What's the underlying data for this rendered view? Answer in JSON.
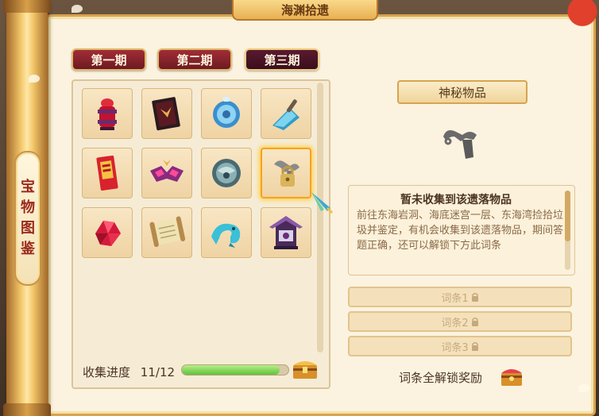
{
  "window": {
    "title": "海渊拾遗",
    "side_label_chars": [
      "宝",
      "物",
      "图",
      "鉴"
    ]
  },
  "tabs": [
    {
      "label": "第一期",
      "active": false
    },
    {
      "label": "第二期",
      "active": false
    },
    {
      "label": "第三期",
      "active": true
    }
  ],
  "grid": {
    "items": [
      {
        "icon": "red-urn-icon",
        "collected": true
      },
      {
        "icon": "dark-book-icon",
        "collected": true
      },
      {
        "icon": "blue-medallion-icon",
        "collected": true
      },
      {
        "icon": "blue-dustpan-icon",
        "collected": true
      },
      {
        "icon": "red-talisman-icon",
        "collected": true
      },
      {
        "icon": "purple-mask-icon",
        "collected": true
      },
      {
        "icon": "stone-orb-icon",
        "collected": true
      },
      {
        "icon": "mystery-locked-icon",
        "collected": false,
        "selected": true
      },
      {
        "icon": "red-crystal-icon",
        "collected": true
      },
      {
        "icon": "scroll-icon",
        "collected": true
      },
      {
        "icon": "jade-dragon-icon",
        "collected": true
      },
      {
        "icon": "purple-shrine-icon",
        "collected": true
      }
    ]
  },
  "progress": {
    "label": "收集进度",
    "value_text": "11/12",
    "current": 11,
    "total": 12
  },
  "detail": {
    "title": "神秘物品",
    "item_icon": "mystery-item-icon",
    "desc_title": "暂未收集到该遗落物品",
    "desc_text": "前往东海岩洞、海底迷宫一层、东海湾捡拾垃圾并鉴定，有机会收集到该遗落物品，期间答题正确，还可以解锁下方此词条",
    "entries": [
      {
        "label": "词条1",
        "locked": true
      },
      {
        "label": "词条2",
        "locked": true
      },
      {
        "label": "词条3",
        "locked": true
      }
    ],
    "reward_label": "词条全解锁奖励"
  },
  "colors": {
    "tab_bg": "#8a2430",
    "tab_active_bg": "#4a1226",
    "paper": "#fbf3e0",
    "progress_fill": "#6fcb45",
    "selected_glow": "#ffcf4a"
  }
}
